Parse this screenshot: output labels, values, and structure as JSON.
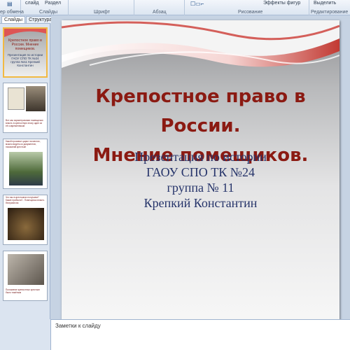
{
  "ribbon": {
    "clipboard_group": "ер обмена",
    "slide_btn": "слайд",
    "section_btn": "Раздел",
    "slides_group": "Слайды",
    "font_group": "Шрифт",
    "paragraph_group": "Абзац",
    "drawing_group": "Рисование",
    "shape_effects": "Эффекты фигур",
    "select_btn": "Выделить",
    "editing_group": "Редактирование"
  },
  "left_pane": {
    "tabs": [
      "Слайды",
      "Структура"
    ],
    "close": "×",
    "thumbnails": [
      {
        "num": "",
        "title": "Крепостное право в России. Мнение помещиков.",
        "sub": "Презентация по истории ГАОУ СПО ТК №24 группа №11 Крепкий Константин"
      },
      {
        "num": "",
        "caption": "Вот как характеризовал помещичью власть в крепостную эпоху один из её современников"
      },
      {
        "num": "",
        "caption": "Какой произвол царил на местах, можно видеть из документов, показаний крестьян"
      },
      {
        "num": "",
        "caption": "Что мы в крестьянах получаем? Какие прибыли?.. Помещичья власть безгранична"
      },
      {
        "num": "",
        "caption": "Положение крепостных крестьян было тяжёлым"
      }
    ]
  },
  "slide": {
    "title_lines": [
      "Крепостное право в России.",
      "Мнение помещиков."
    ],
    "subtitle_lines": [
      "Презентация по истории",
      "ГАОУ СПО ТК  №24",
      "группа  № 11",
      "Крепкий Константин"
    ]
  },
  "notes": {
    "placeholder": "Заметки к слайду"
  },
  "colors": {
    "title": "#8b1a12",
    "subtitle": "#26346a",
    "wave": "#c0392b"
  }
}
